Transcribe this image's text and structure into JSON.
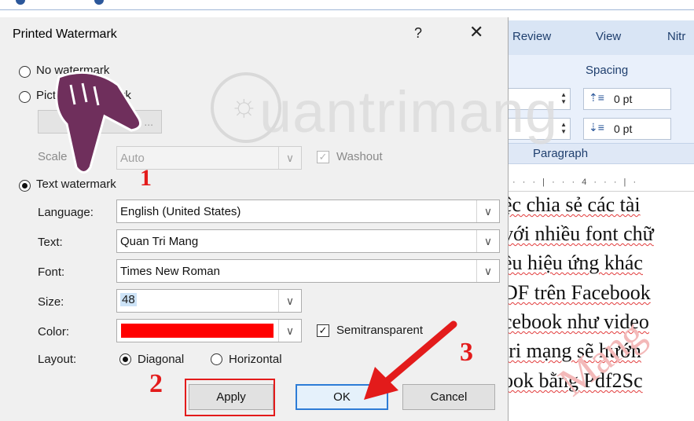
{
  "word": {
    "tabs": [
      "Review",
      "View",
      "Nitr"
    ],
    "spacing_label": "Spacing",
    "spacing_before": "0 pt",
    "spacing_after": "0 pt",
    "paragraph_label": "Paragraph",
    "ruler_text": "· · · | · · · 4 · · · | ·",
    "doc_lines": [
      "ệc chia sẻ các tài",
      "với nhiều font chữ",
      "ều hiệu ứng khác",
      "DF trên Facebook",
      "cebook như video",
      "tri mạng sẽ hướn",
      "ook bằng Pdf2Sc"
    ],
    "doc_watermark": "Mang"
  },
  "dialog": {
    "title": "Printed Watermark",
    "help": "?",
    "close": "✕",
    "no_watermark": "No watermark",
    "picture_watermark": "Picture watermark",
    "select_picture": "...",
    "scale_label": "Scale",
    "scale_value": "Auto",
    "washout_label": "Washout",
    "text_watermark": "Text watermark",
    "language_label": "Language:",
    "language_value": "English (United States)",
    "text_label": "Text:",
    "text_value": "Quan Tri Mang",
    "font_label": "Font:",
    "font_value": "Times New Roman",
    "size_label": "Size:",
    "size_value": "48",
    "color_label": "Color:",
    "color_value": "#ff0000",
    "semitransparent_label": "Semitransparent",
    "layout_label": "Layout:",
    "diagonal_label": "Diagonal",
    "horizontal_label": "Horizontal",
    "apply_label": "Apply",
    "ok_label": "OK",
    "cancel_label": "Cancel"
  },
  "overlay": {
    "brand": "uantrimang",
    "step1": "1",
    "step2": "2",
    "step3": "3",
    "accent_color": "#e31b1b"
  },
  "icons": [
    "hand-pointer-icon",
    "lightbulb-logo-icon",
    "red-arrow-icon",
    "chevron-down-icon",
    "checkmark-icon"
  ]
}
